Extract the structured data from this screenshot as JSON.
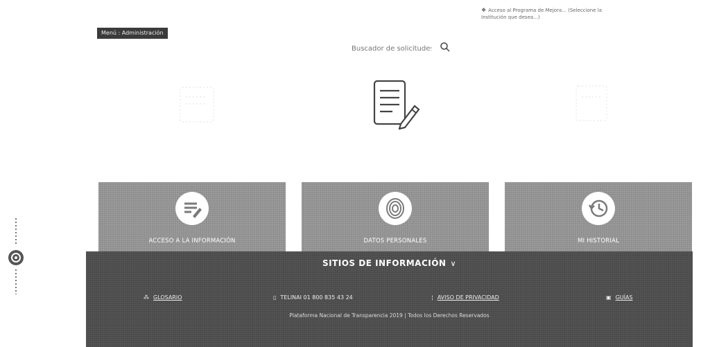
{
  "top_note": "Acceso al Programa de Mejora... (Seleccione la Institución que desea...)",
  "menu": {
    "label": "Menú : Administración"
  },
  "search": {
    "placeholder": "Buscador de solicitudes"
  },
  "cards": [
    {
      "label": "ACCESO A LA INFORMACIÓN"
    },
    {
      "label": "DATOS PERSONALES"
    },
    {
      "label": "MI HISTORIAL"
    }
  ],
  "footer": {
    "sitios_label": "SITIOS DE INFORMACIÓN",
    "links": [
      {
        "label": "GLOSARIO"
      },
      {
        "label": "TELINAI 01 800 835 43 24"
      },
      {
        "label": "AVISO DE PRIVACIDAD"
      },
      {
        "label": "GUÍAS"
      }
    ],
    "copyright": "Plataforma Nacional de Transparencia 2019 | Todos los Derechos Reservados"
  },
  "colors": {
    "card_bg": "#8d8d8d",
    "footer_bg": "#4a4a4a"
  }
}
